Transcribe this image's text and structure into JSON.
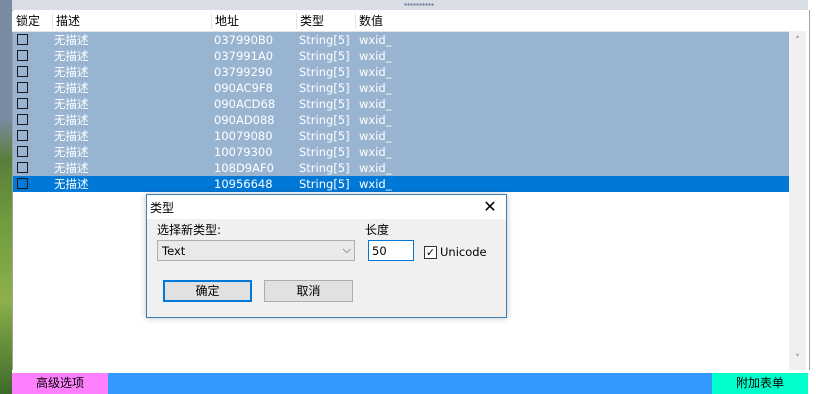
{
  "table": {
    "columns": {
      "lock": "锁定",
      "description": "描述",
      "address": "地址",
      "type": "类型",
      "value": "数值"
    },
    "rows": [
      {
        "description": "无描述",
        "address": "037990B0",
        "type": "String[5]",
        "value": "wxid_",
        "locked": false
      },
      {
        "description": "无描述",
        "address": "037991A0",
        "type": "String[5]",
        "value": "wxid_",
        "locked": false
      },
      {
        "description": "无描述",
        "address": "03799290",
        "type": "String[5]",
        "value": "wxid_",
        "locked": false
      },
      {
        "description": "无描述",
        "address": "090AC9F8",
        "type": "String[5]",
        "value": "wxid_",
        "locked": false
      },
      {
        "description": "无描述",
        "address": "090ACD68",
        "type": "String[5]",
        "value": "wxid_",
        "locked": false
      },
      {
        "description": "无描述",
        "address": "090AD088",
        "type": "String[5]",
        "value": "wxid_",
        "locked": false
      },
      {
        "description": "无描述",
        "address": "10079080",
        "type": "String[5]",
        "value": "wxid_",
        "locked": false
      },
      {
        "description": "无描述",
        "address": "10079300",
        "type": "String[5]",
        "value": "wxid_",
        "locked": false
      },
      {
        "description": "无描述",
        "address": "108D9AF0",
        "type": "String[5]",
        "value": "wxid_",
        "locked": false
      },
      {
        "description": "无描述",
        "address": "10956648",
        "type": "String[5]",
        "value": "wxid_",
        "locked": false
      }
    ]
  },
  "bottom": {
    "advanced_label": "高级选项",
    "add_table_label": "附加表单"
  },
  "dialog": {
    "title": "类型",
    "select_label": "选择新类型:",
    "selected_type": "Text",
    "length_label": "长度",
    "length_value": "50",
    "unicode_label": "Unicode",
    "unicode_checked": true,
    "ok_label": "确定",
    "cancel_label": "取消"
  },
  "colors": {
    "row_selected": "#99b4d1",
    "row_active": "#0078d7",
    "bottom_bar": "#3399ff",
    "advanced_button": "#ff80ff",
    "add_table_button": "#00ffcc"
  },
  "icons": {
    "close": "close-icon",
    "dropdown": "chevron-down-icon",
    "scroll_up": "chevron-up-icon",
    "scroll_down": "chevron-down-icon"
  }
}
